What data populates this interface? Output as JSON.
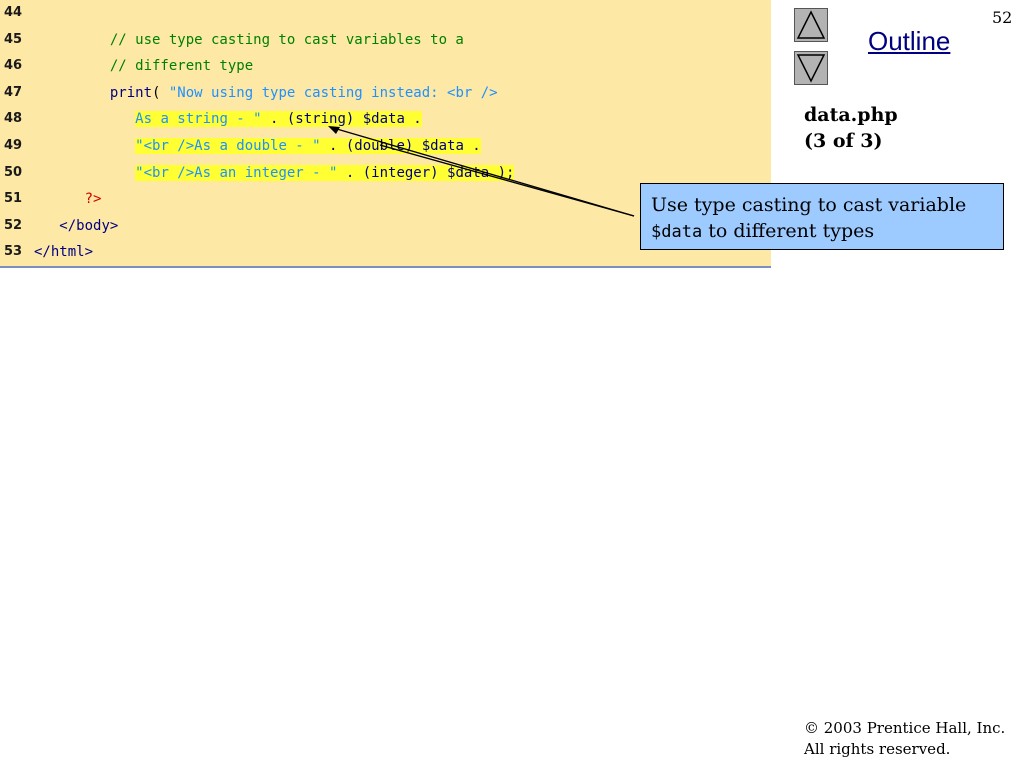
{
  "page_number": "52",
  "outline_label": "Outline",
  "file_title_line1": "data.php",
  "file_title_line2": "(3 of 3)",
  "callout": {
    "text_before": "Use type casting to cast variable",
    "variable": "$data",
    "text_after": "to different types"
  },
  "footer": {
    "copyright": "© 2003 Prentice Hall, Inc.",
    "rights": "All rights reserved."
  },
  "code_lines": [
    {
      "num": "44",
      "parts": []
    },
    {
      "num": "45",
      "parts": [
        {
          "text": "         // use type casting to cast variables to a",
          "cls": "cm"
        }
      ]
    },
    {
      "num": "46",
      "parts": [
        {
          "text": "         // different type",
          "cls": "cm"
        }
      ]
    },
    {
      "num": "47",
      "parts": [
        {
          "text": "         ",
          "cls": ""
        },
        {
          "text": "print",
          "cls": "kw"
        },
        {
          "text": "( ",
          "cls": ""
        },
        {
          "text": "\"Now using type casting instead: <br />",
          "cls": "st"
        }
      ]
    },
    {
      "num": "48",
      "parts": [
        {
          "text": "            ",
          "cls": ""
        },
        {
          "text": "As a string - \"",
          "cls": "st hl"
        },
        {
          "text": " . (string) $data .",
          "cls": "kw hl"
        }
      ]
    },
    {
      "num": "49",
      "parts": [
        {
          "text": "            ",
          "cls": ""
        },
        {
          "text": "\"<br />As a double - \"",
          "cls": "st hl"
        },
        {
          "text": " . (double) $data .",
          "cls": "kw hl"
        }
      ]
    },
    {
      "num": "50",
      "parts": [
        {
          "text": "            ",
          "cls": ""
        },
        {
          "text": "\"<br />As an integer - \"",
          "cls": "st hl"
        },
        {
          "text": " . (integer) $data );",
          "cls": "kw hl"
        }
      ]
    },
    {
      "num": "51",
      "parts": [
        {
          "text": "      ",
          "cls": ""
        },
        {
          "text": "?>",
          "cls": "red"
        }
      ]
    },
    {
      "num": "52",
      "parts": [
        {
          "text": "   ",
          "cls": ""
        },
        {
          "text": "</body>",
          "cls": "tg"
        }
      ]
    },
    {
      "num": "53",
      "parts": [
        {
          "text": "</html>",
          "cls": "tg"
        }
      ]
    }
  ]
}
